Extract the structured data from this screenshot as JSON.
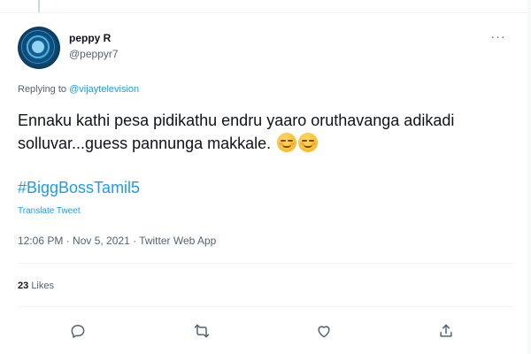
{
  "author": {
    "display_name": "peppy R",
    "handle": "@peppyr7"
  },
  "reply_context": {
    "prefix": "Replying to ",
    "mention": "@vijaytelevision"
  },
  "tweet": {
    "text": "Ennaku kathi pesa pidikathu endru yaaro oruthavanga adikadi solluvar...guess pannunga makkale.",
    "emojis": [
      "smirking-face-emoji",
      "smirking-face-emoji"
    ],
    "hashtag": "#BiggBossTamil5",
    "translate_label": "Translate Tweet",
    "timestamp": "12:06 PM · Nov 5, 2021 · Twitter Web App"
  },
  "stats": {
    "likes_count": "23",
    "likes_label": "Likes"
  },
  "actions": {
    "reply": "reply-icon",
    "retweet": "retweet-icon",
    "like": "heart-icon",
    "share": "share-icon"
  },
  "colors": {
    "accent": "#1d9bf0",
    "text": "#0f1419",
    "secondary": "#536471",
    "divider": "#eff3f4"
  }
}
